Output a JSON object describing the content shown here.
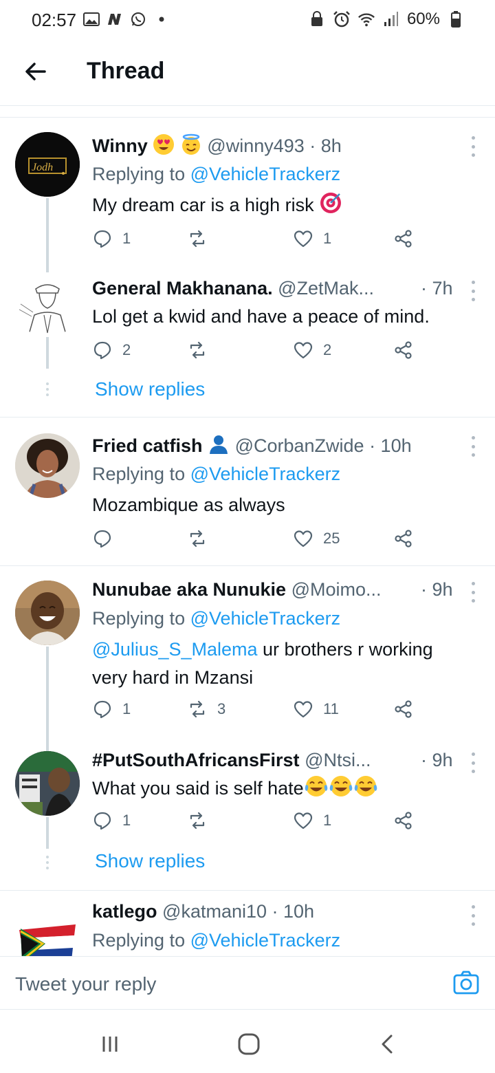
{
  "status_bar": {
    "time": "02:57",
    "battery": "60%",
    "left_icons": [
      "gallery-icon",
      "n-icon",
      "whatsapp-icon",
      "dot-icon"
    ],
    "right_icons": [
      "lock-icon",
      "alarm-icon",
      "wifi-icon",
      "signal-icon",
      "battery-icon"
    ]
  },
  "header": {
    "title": "Thread"
  },
  "tweets": [
    {
      "name": "Winny",
      "handle": "@winny493 · 8h",
      "reply_prefix": "Replying to ",
      "reply_to": "@VehicleTrackerz",
      "text": "My dream car is a high risk",
      "replies": "1",
      "retweets": "",
      "likes": "1"
    },
    {
      "name": "General Makhanana.",
      "handle": "@ZetMak...",
      "time": "· 7h",
      "text": "Lol get a kwid and have a peace of mind.",
      "replies": "2",
      "retweets": "",
      "likes": "2"
    },
    {
      "name": "Fried catfish",
      "handle": "@CorbanZwide · 10h",
      "reply_prefix": "Replying to ",
      "reply_to": "@VehicleTrackerz",
      "text": "Mozambique as always",
      "replies": "",
      "retweets": "",
      "likes": "25"
    },
    {
      "name": "Nunubae aka Nunukie",
      "handle": "@Moimo...",
      "time": "· 9h",
      "reply_prefix": "Replying to ",
      "reply_to": "@VehicleTrackerz",
      "text_mention": "@Julius_S_Malema",
      "text_line1": " ur brothers r working",
      "text_line2": "very hard in Mzansi",
      "replies": "1",
      "retweets": "3",
      "likes": "11"
    },
    {
      "name": "#PutSouthAfricansFirst",
      "handle": "@Ntsi...",
      "time": "· 9h",
      "text": "What you said is self hate",
      "replies": "1",
      "retweets": "",
      "likes": "1"
    },
    {
      "name": "katlego",
      "handle": "@katmani10 · 10h",
      "reply_prefix": "Replying to ",
      "reply_to": "@VehicleTrackerz"
    }
  ],
  "show_replies_label": "Show replies",
  "reply_bar": {
    "placeholder": "Tweet your reply"
  },
  "colors": {
    "accent": "#1d9bf0",
    "muted": "#536471",
    "text": "#0f1419"
  }
}
